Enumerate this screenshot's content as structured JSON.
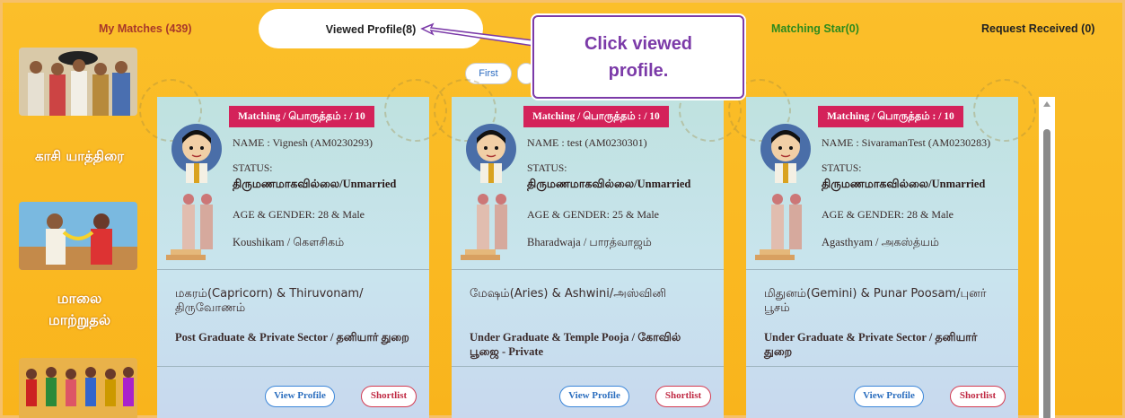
{
  "tabs": {
    "my_matches": "My Matches (439)",
    "viewed_profile": "Viewed Profile(8)",
    "matching_star": "Matching Star(0)",
    "request_received": "Request Received (0)"
  },
  "pager": {
    "first": "First",
    "next_partial": ""
  },
  "callout": {
    "line1": "Click viewed",
    "line2": "profile."
  },
  "sidebar": {
    "items": [
      {
        "label": "காசி யாத்திரை",
        "icon": "kasi-yathirai-image"
      },
      {
        "label_line1": "மாலை",
        "label_line2": "மாற்றுதல்",
        "icon": "malai-maatrudhal-image"
      },
      {
        "icon": "wedding-crowd-image"
      }
    ]
  },
  "cards": [
    {
      "badge": "Matching / பொருத்தம் : / 10",
      "name": "NAME : Vignesh (AM0230293)",
      "status_label": "STATUS:",
      "status_value": "திருமணமாகவில்லை/Unmarried",
      "age_gender": "AGE & GENDER: 28 & Male",
      "gothram": "Koushikam / கௌசிகம்",
      "rasi_star": "மகரம்(Capricorn) & Thiruvonam/ திருவோணம்",
      "education_job": "Post Graduate & Private Sector / தனியார் துறை",
      "view_btn": "View Profile",
      "shortlist_btn": "Shortlist"
    },
    {
      "badge": "Matching / பொருத்தம் : / 10",
      "name": "NAME : test (AM0230301)",
      "status_label": "STATUS:",
      "status_value": "திருமணமாகவில்லை/Unmarried",
      "age_gender": "AGE & GENDER: 25 & Male",
      "gothram": "Bharadwaja / பாரத்வாஜம்",
      "rasi_star": "மேஷம்(Aries) & Ashwini/அஸ்வினி",
      "education_job": "Under Graduate & Temple Pooja / கோவில் பூஜை - Private",
      "view_btn": "View Profile",
      "shortlist_btn": "Shortlist"
    },
    {
      "badge": "Matching / பொருத்தம் : / 10",
      "name": "NAME : SivaramanTest (AM0230283)",
      "status_label": "STATUS:",
      "status_value": "திருமணமாகவில்லை/Unmarried",
      "age_gender": "AGE & GENDER: 28 & Male",
      "gothram": "Agasthyam / அகஸ்த்யம்",
      "rasi_star": "மிதுனம்(Gemini) & Punar Poosam/புனர் பூசம்",
      "education_job": "Under Graduate & Private Sector / தனியார் துறை",
      "view_btn": "View Profile",
      "shortlist_btn": "Shortlist"
    }
  ],
  "colors": {
    "background": "#fbbf2a",
    "badge": "#d4225a",
    "callout_accent": "#7b3aa8",
    "tab_matches": "#a8382a",
    "tab_star": "#2c8a1d"
  }
}
